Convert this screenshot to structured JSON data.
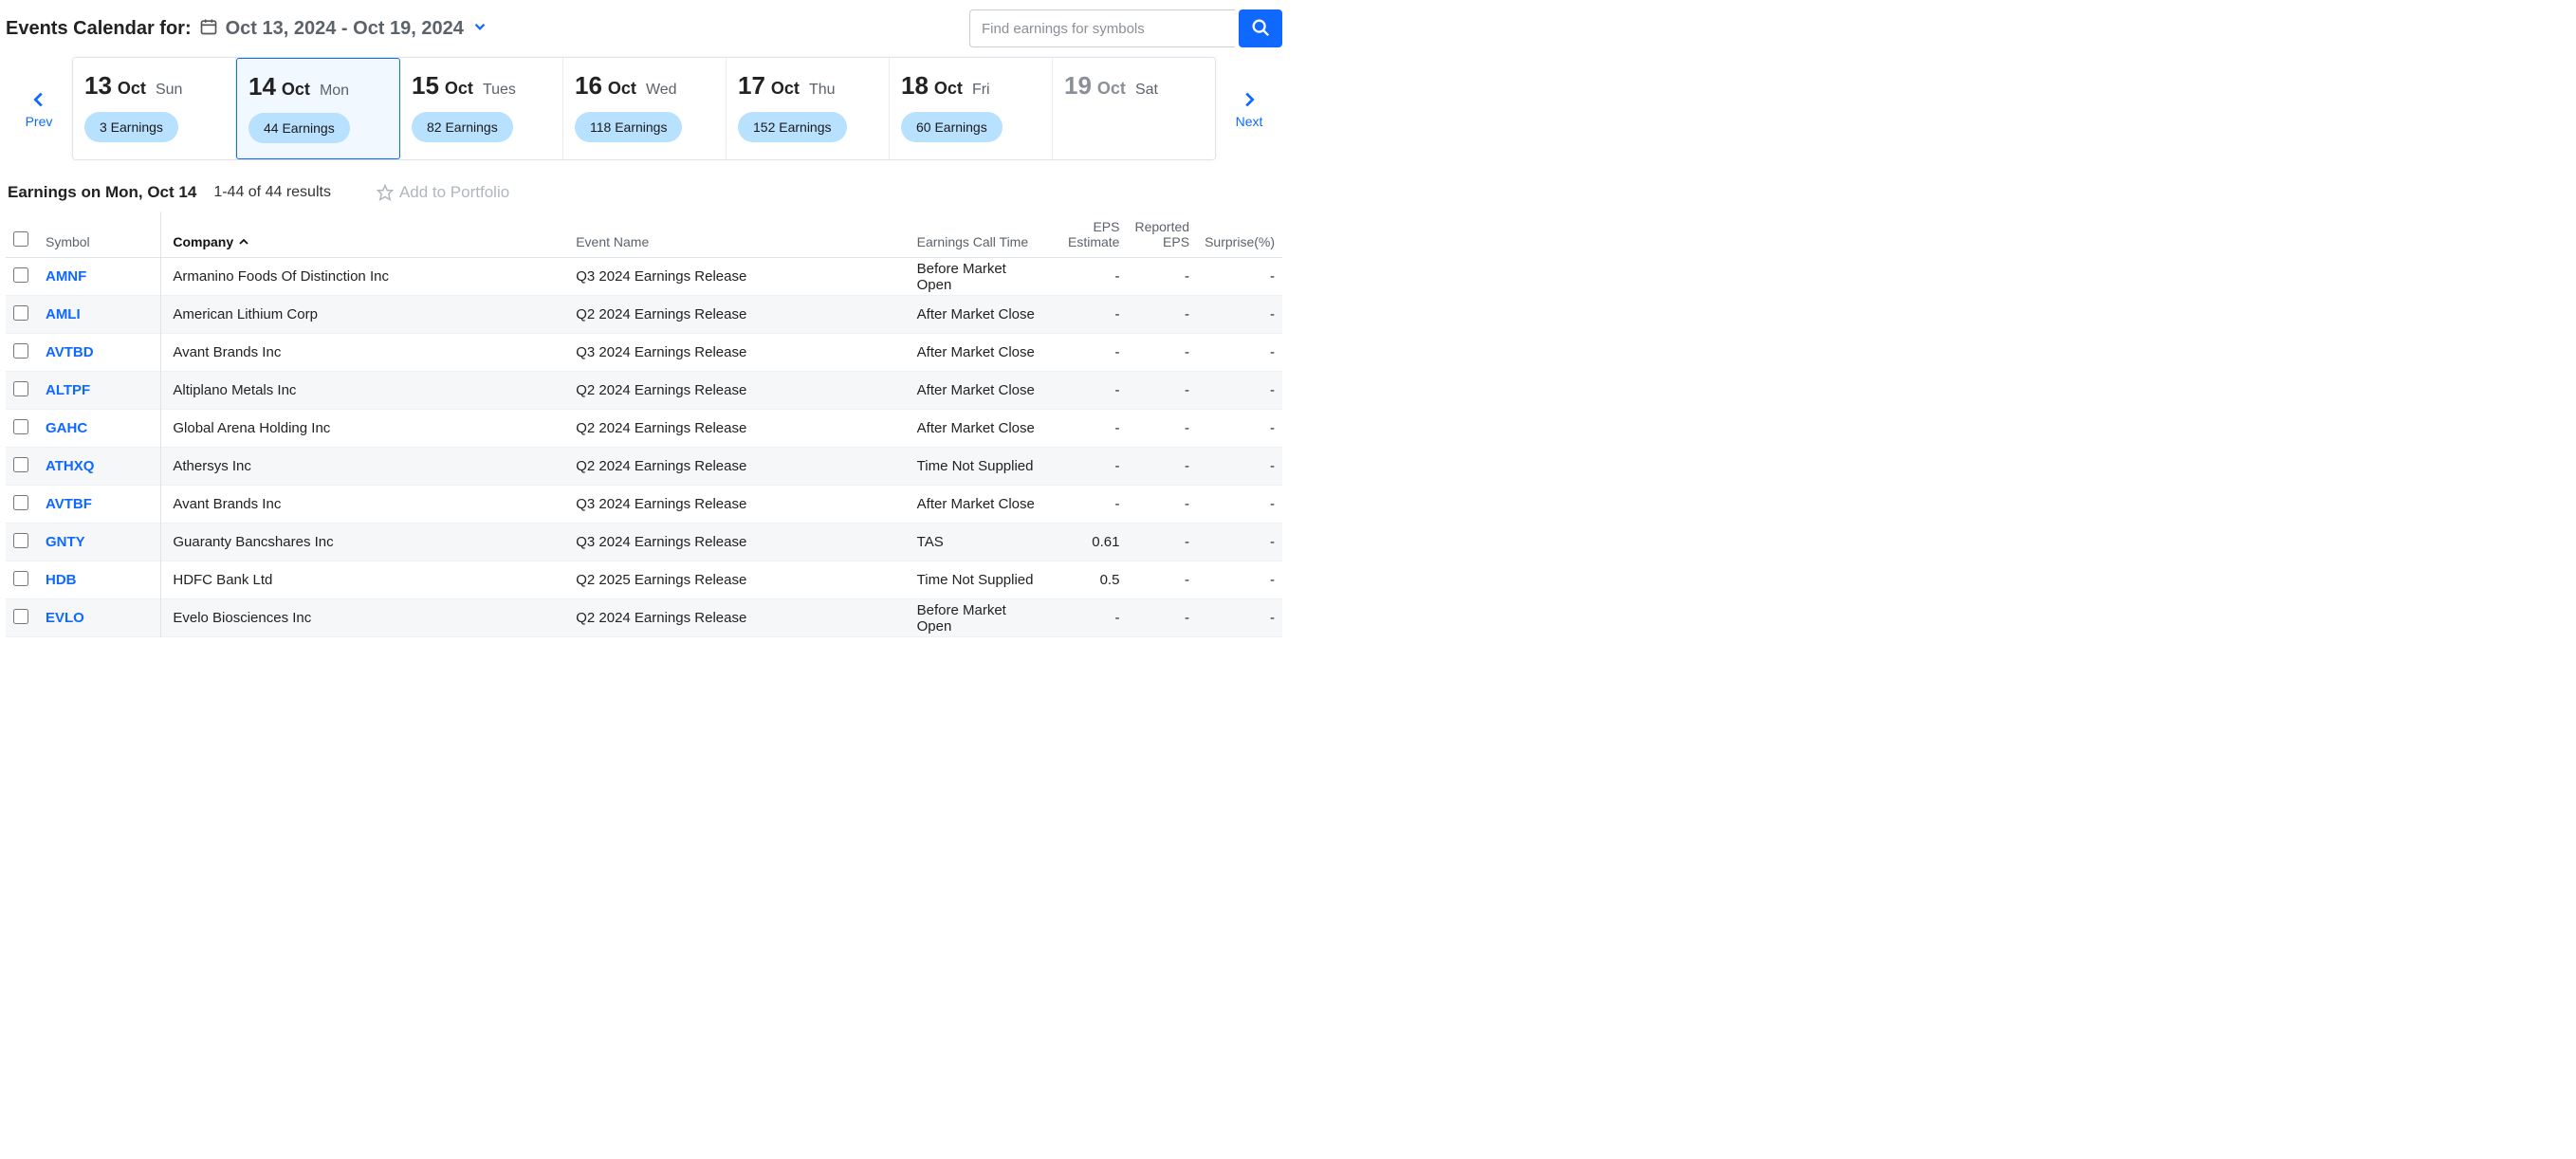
{
  "header": {
    "title": "Events Calendar for:",
    "date_range": "Oct 13, 2024 - Oct 19, 2024"
  },
  "search": {
    "placeholder": "Find earnings for symbols"
  },
  "nav": {
    "prev": "Prev",
    "next": "Next"
  },
  "days": [
    {
      "num": "13",
      "mon": "Oct",
      "dow": "Sun",
      "pill": "3 Earnings",
      "selected": false,
      "disabled": false
    },
    {
      "num": "14",
      "mon": "Oct",
      "dow": "Mon",
      "pill": "44 Earnings",
      "selected": true,
      "disabled": false
    },
    {
      "num": "15",
      "mon": "Oct",
      "dow": "Tues",
      "pill": "82 Earnings",
      "selected": false,
      "disabled": false
    },
    {
      "num": "16",
      "mon": "Oct",
      "dow": "Wed",
      "pill": "118 Earnings",
      "selected": false,
      "disabled": false
    },
    {
      "num": "17",
      "mon": "Oct",
      "dow": "Thu",
      "pill": "152 Earnings",
      "selected": false,
      "disabled": false
    },
    {
      "num": "18",
      "mon": "Oct",
      "dow": "Fri",
      "pill": "60 Earnings",
      "selected": false,
      "disabled": false
    },
    {
      "num": "19",
      "mon": "Oct",
      "dow": "Sat",
      "pill": "",
      "selected": false,
      "disabled": true
    }
  ],
  "results": {
    "title": "Earnings on Mon, Oct 14",
    "count": "1-44 of 44 results",
    "add_to_portfolio": "Add to Portfolio"
  },
  "columns": {
    "symbol": "Symbol",
    "company": "Company",
    "event": "Event Name",
    "time": "Earnings Call Time",
    "eps_est_l1": "EPS",
    "eps_est_l2": "Estimate",
    "eps_rep_l1": "Reported",
    "eps_rep_l2": "EPS",
    "surprise": "Surprise(%)"
  },
  "rows": [
    {
      "symbol": "AMNF",
      "company": "Armanino Foods Of Distinction Inc",
      "event": "Q3 2024 Earnings Release",
      "time": "Before Market Open",
      "eps_est": "-",
      "eps_rep": "-",
      "surprise": "-"
    },
    {
      "symbol": "AMLI",
      "company": "American Lithium Corp",
      "event": "Q2 2024 Earnings Release",
      "time": "After Market Close",
      "eps_est": "-",
      "eps_rep": "-",
      "surprise": "-"
    },
    {
      "symbol": "AVTBD",
      "company": "Avant Brands Inc",
      "event": "Q3 2024 Earnings Release",
      "time": "After Market Close",
      "eps_est": "-",
      "eps_rep": "-",
      "surprise": "-"
    },
    {
      "symbol": "ALTPF",
      "company": "Altiplano Metals Inc",
      "event": "Q2 2024 Earnings Release",
      "time": "After Market Close",
      "eps_est": "-",
      "eps_rep": "-",
      "surprise": "-"
    },
    {
      "symbol": "GAHC",
      "company": "Global Arena Holding Inc",
      "event": "Q2 2024 Earnings Release",
      "time": "After Market Close",
      "eps_est": "-",
      "eps_rep": "-",
      "surprise": "-"
    },
    {
      "symbol": "ATHXQ",
      "company": "Athersys Inc",
      "event": "Q2 2024 Earnings Release",
      "time": "Time Not Supplied",
      "eps_est": "-",
      "eps_rep": "-",
      "surprise": "-"
    },
    {
      "symbol": "AVTBF",
      "company": "Avant Brands Inc",
      "event": "Q3 2024 Earnings Release",
      "time": "After Market Close",
      "eps_est": "-",
      "eps_rep": "-",
      "surprise": "-"
    },
    {
      "symbol": "GNTY",
      "company": "Guaranty Bancshares Inc",
      "event": "Q3 2024 Earnings Release",
      "time": "TAS",
      "eps_est": "0.61",
      "eps_rep": "-",
      "surprise": "-"
    },
    {
      "symbol": "HDB",
      "company": "HDFC Bank Ltd",
      "event": "Q2 2025 Earnings Release",
      "time": "Time Not Supplied",
      "eps_est": "0.5",
      "eps_rep": "-",
      "surprise": "-"
    },
    {
      "symbol": "EVLO",
      "company": "Evelo Biosciences Inc",
      "event": "Q2 2024 Earnings Release",
      "time": "Before Market Open",
      "eps_est": "-",
      "eps_rep": "-",
      "surprise": "-"
    }
  ]
}
